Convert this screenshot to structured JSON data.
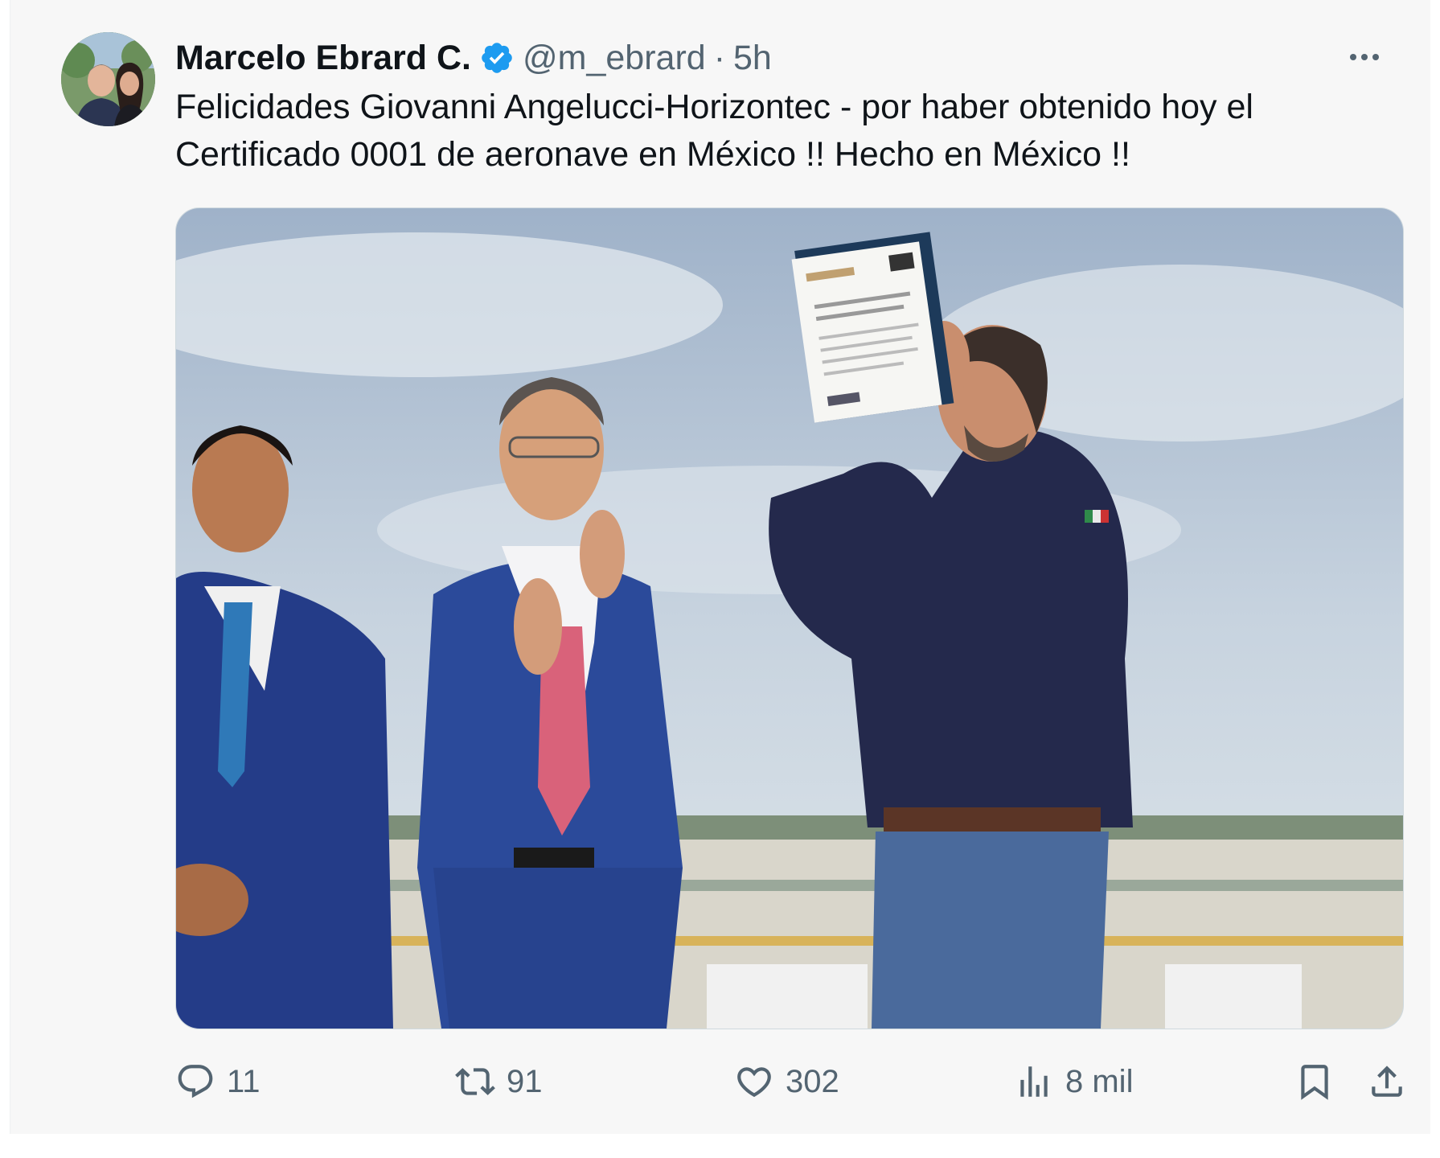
{
  "author": {
    "name": "Marcelo Ebrard C.",
    "handle": "@m_ebrard",
    "separator": "·",
    "time": "5h",
    "verified_icon": "verified-badge-icon",
    "verified_color": "#1d9bf0"
  },
  "tweet": {
    "text": "Felicidades Giovanni Angelucci-Horizontec - por haber obtenido hoy el Certificado 0001 de aeronave en México !! Hecho en México !!"
  },
  "media": {
    "description_icon": "photo"
  },
  "actions": {
    "replies": "11",
    "reposts": "91",
    "likes": "302",
    "views": "8 mil"
  },
  "colors": {
    "text_primary": "#0f1419",
    "text_secondary": "#536471",
    "accent": "#1d9bf0",
    "card_bg": "#f7f7f7"
  }
}
